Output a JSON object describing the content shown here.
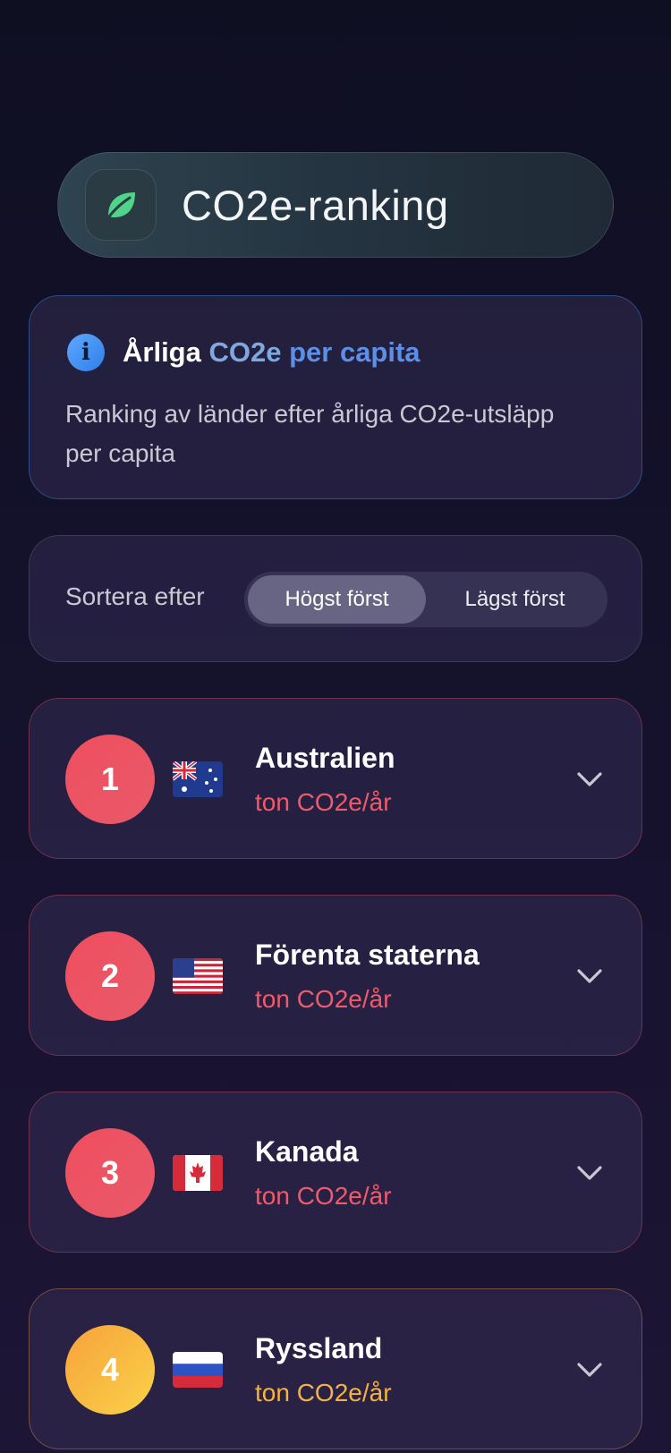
{
  "header": {
    "title": "CO2e-ranking",
    "icon": "leaf-icon",
    "icon_color": "#4fd48a"
  },
  "info": {
    "icon": "info-icon",
    "title_part1": "Årliga",
    "title_part2": "CO2e",
    "title_part3": "per capita",
    "description": "Ranking av länder efter årliga CO2e-utsläpp per capita"
  },
  "sort": {
    "label": "Sortera efter",
    "options": [
      "Högst först",
      "Lägst först"
    ],
    "selected": "Högst först"
  },
  "rankings": [
    {
      "rank": "1",
      "country": "Australien",
      "unit": "ton CO2e/år",
      "flag": "flag-australia",
      "color": "#f04e5e"
    },
    {
      "rank": "2",
      "country": "Förenta staterna",
      "unit": "ton CO2e/år",
      "flag": "flag-usa",
      "color": "#f04e5e"
    },
    {
      "rank": "3",
      "country": "Kanada",
      "unit": "ton CO2e/år",
      "flag": "flag-canada",
      "color": "#f04e5e"
    },
    {
      "rank": "4",
      "country": "Ryssland",
      "unit": "ton CO2e/år",
      "flag": "flag-russia",
      "color": "#f6b23e"
    }
  ]
}
